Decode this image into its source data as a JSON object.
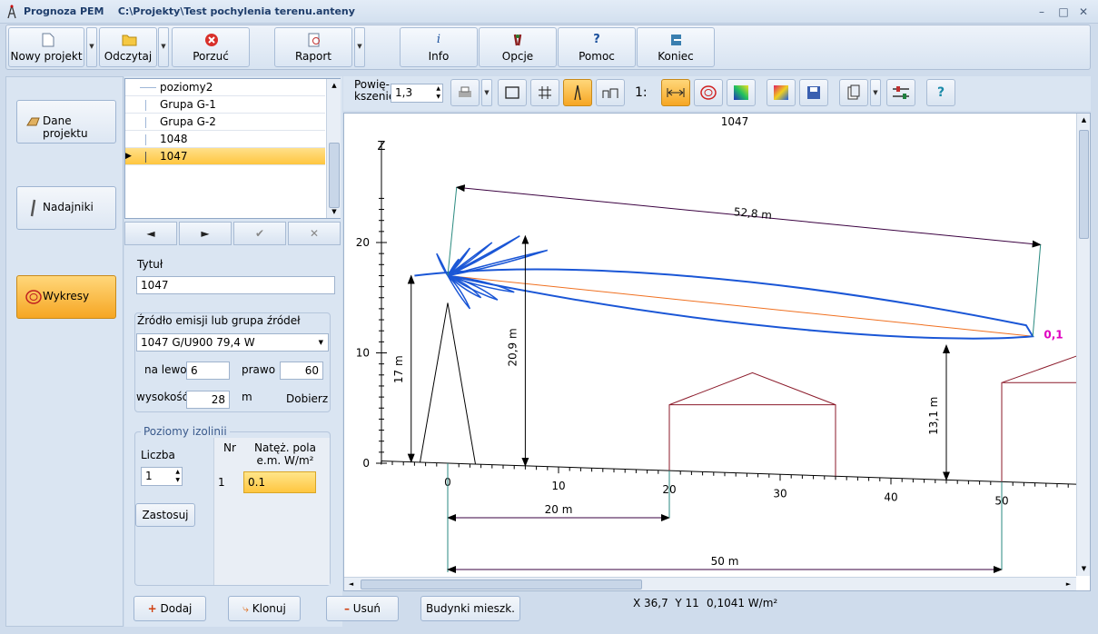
{
  "window": {
    "app_name": "Prognoza PEM",
    "path": "C:\\Projekty\\Test pochylenia terenu.anteny",
    "minimize": "–",
    "maximize": "□",
    "close": "✕"
  },
  "toolbar": {
    "new_project": "Nowy projekt",
    "open": "Odczytaj",
    "discard": "Porzuć",
    "report": "Raport",
    "info": "Info",
    "options": "Opcje",
    "help": "Pomoc",
    "exit": "Koniec",
    "info_icon": "i",
    "help_icon": "?"
  },
  "nav": {
    "project_data": "Dane projektu",
    "transmitters": "Nadajniki",
    "charts": "Wykresy"
  },
  "list": {
    "items": [
      {
        "label": "poziomy2"
      },
      {
        "label": "Grupa G-1"
      },
      {
        "label": "Grupa G-2"
      },
      {
        "label": "1048"
      },
      {
        "label": "1047"
      }
    ],
    "nav": {
      "prev": "◄",
      "next": "►",
      "ok": "✔",
      "cancel": "✕"
    }
  },
  "form": {
    "title_label": "Tytuł",
    "title_value": "1047",
    "source_label": "Źródło emisji lub grupa źródeł",
    "source_value": "1047 G/U900 79,4 W",
    "left_label": "na lewo",
    "left_value": "6",
    "right_label": "prawo",
    "right_value": "60",
    "height_label": "wysokość",
    "height_value": "28",
    "unit": "m",
    "fit_label": "Dobierz",
    "isolines_label": "Poziomy izolinii",
    "count_label": "Liczba",
    "count_value": "1",
    "apply_label": "Zastosuj",
    "table": {
      "headers": [
        "Nr",
        "Natęż. pola e.m. W/m²"
      ],
      "rows": [
        [
          "1",
          "0.1"
        ]
      ]
    }
  },
  "plot_toolbar": {
    "zoom_label_1": "Powię-",
    "zoom_label_2": "kszenie",
    "zoom_value": "1,3",
    "scale_label": "1:"
  },
  "chart_data": {
    "type": "line",
    "title": "1047",
    "ylabel": "Z",
    "ylim": [
      0,
      25
    ],
    "xlim": [
      -6,
      57
    ],
    "x_ticks": [
      "0",
      "10",
      "20",
      "30",
      "40",
      "50"
    ],
    "y_ticks": [
      "0",
      "10",
      "20"
    ],
    "dimensions": [
      "52,8 m",
      "20,9 m",
      "17 m",
      "13,1 m",
      "20 m",
      "50 m"
    ],
    "isoline_label": "0,1",
    "colors": {
      "pattern": "#1a56d6",
      "line": "#f07020",
      "building": "#8b1a2a",
      "dim": "#3a0040",
      "tower": "#2a8a80",
      "label": "#e000c0"
    }
  },
  "bottom": {
    "add": "Dodaj",
    "clone": "Klonuj",
    "delete": "Usuń",
    "buildings": "Budynki mieszk.",
    "coords": "X 36,7  Y 11",
    "field": "0,1041 W/m²"
  }
}
